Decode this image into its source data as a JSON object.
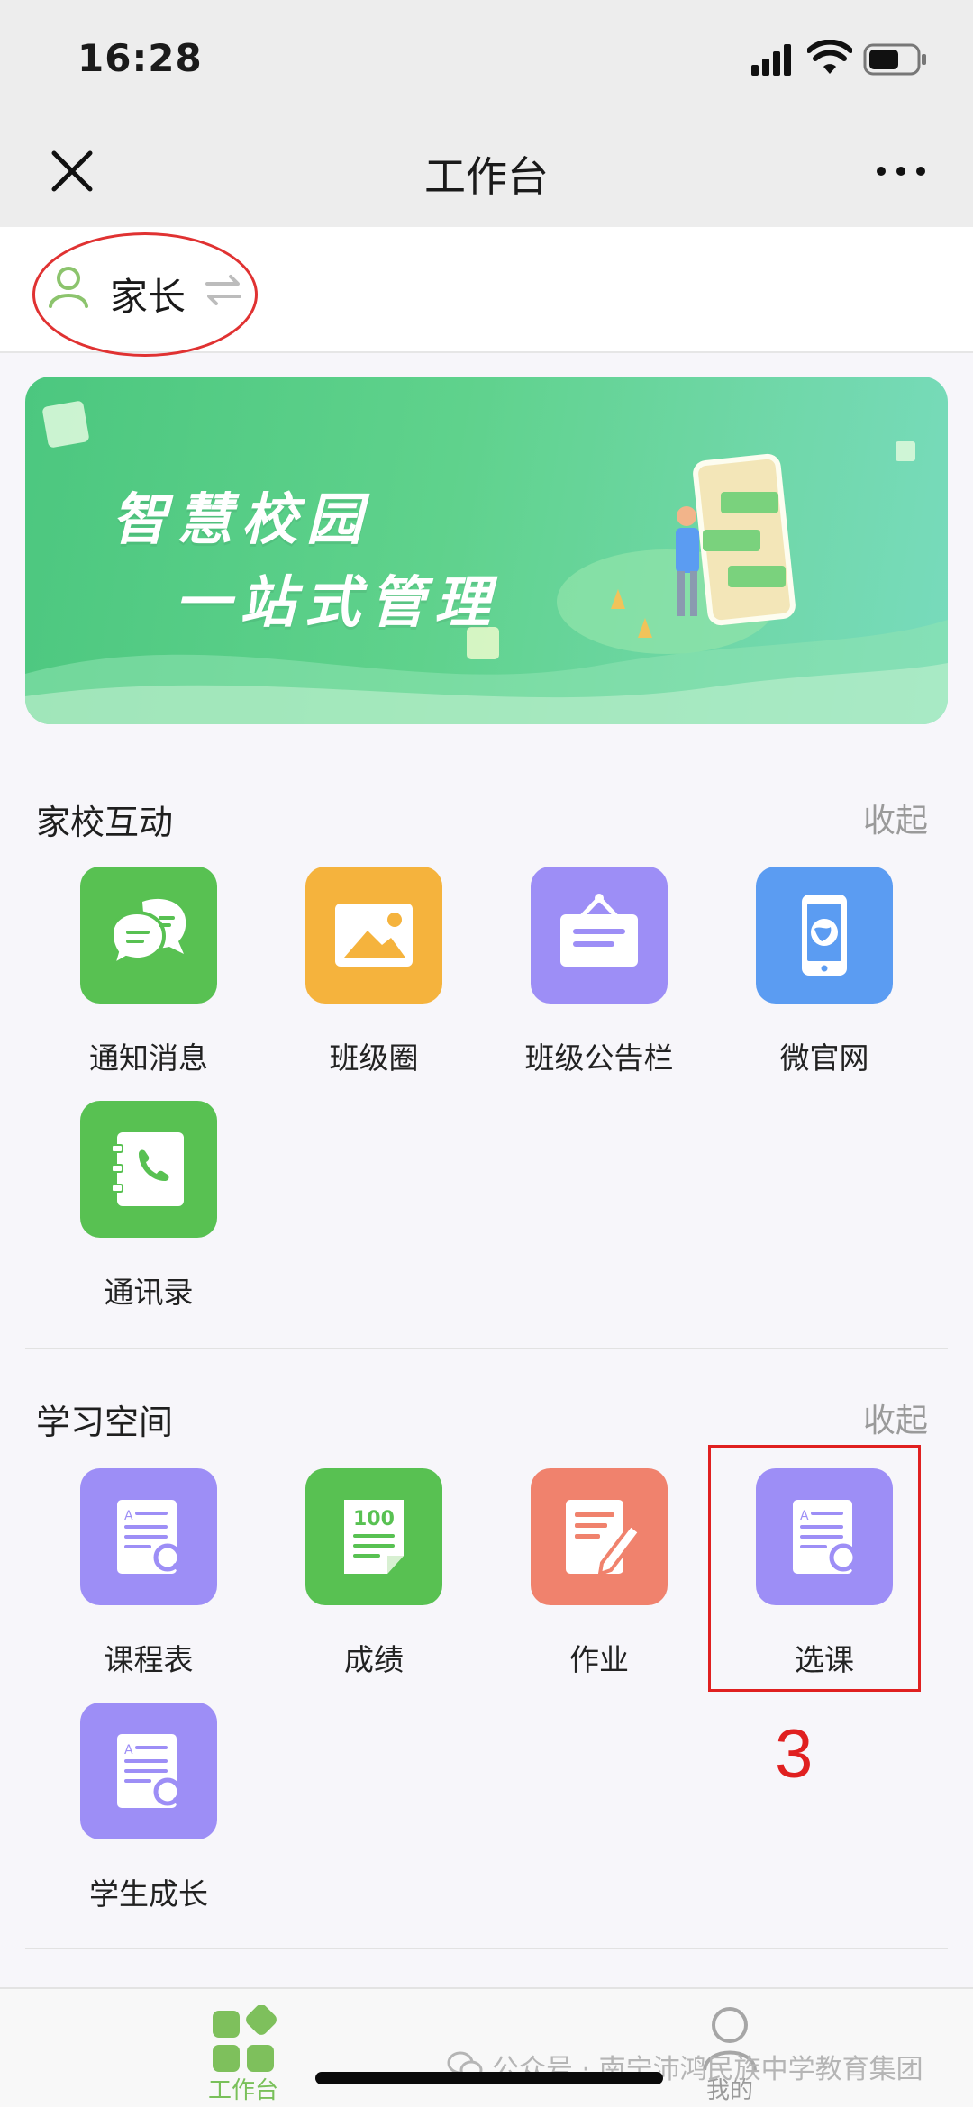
{
  "status_bar": {
    "time": "16:28"
  },
  "nav": {
    "title": "工作台"
  },
  "role": {
    "label": "家长"
  },
  "banner": {
    "line1": "智慧校园",
    "line2": "一站式管理"
  },
  "sections": [
    {
      "title": "家校互动",
      "collapse_label": "收起",
      "items": [
        {
          "label": "通知消息",
          "icon": "chat-bubbles-icon",
          "color": "#58c152"
        },
        {
          "label": "班级圈",
          "icon": "image-icon",
          "color": "#f5b33d"
        },
        {
          "label": "班级公告栏",
          "icon": "notice-board-icon",
          "color": "#9d8ef6"
        },
        {
          "label": "微官网",
          "icon": "phone-globe-icon",
          "color": "#5b9cf2"
        },
        {
          "label": "通讯录",
          "icon": "contacts-phone-icon",
          "color": "#58c152"
        }
      ]
    },
    {
      "title": "学习空间",
      "collapse_label": "收起",
      "items": [
        {
          "label": "课程表",
          "icon": "document-search-icon",
          "color": "#9d8ef6"
        },
        {
          "label": "成绩",
          "icon": "score-100-icon",
          "color": "#58c152"
        },
        {
          "label": "作业",
          "icon": "edit-document-icon",
          "color": "#f0826d"
        },
        {
          "label": "选课",
          "icon": "document-search-icon",
          "color": "#9d8ef6"
        },
        {
          "label": "学生成长",
          "icon": "document-search-icon",
          "color": "#9d8ef6"
        }
      ]
    }
  ],
  "annotation": {
    "step_number": "3",
    "color": "#e02020"
  },
  "score_icon_text": "100",
  "tabbar": {
    "tabs": [
      {
        "label": "工作台",
        "icon": "grid-icon",
        "active": true
      },
      {
        "label": "我的",
        "icon": "user-icon",
        "active": false
      }
    ]
  },
  "watermark": "公众号 · 南宁沛鸿民族中学教育集团",
  "colors": {
    "accent": "#79c05a",
    "nav_bg": "#ededed",
    "page_bg": "#f7f6fa"
  }
}
